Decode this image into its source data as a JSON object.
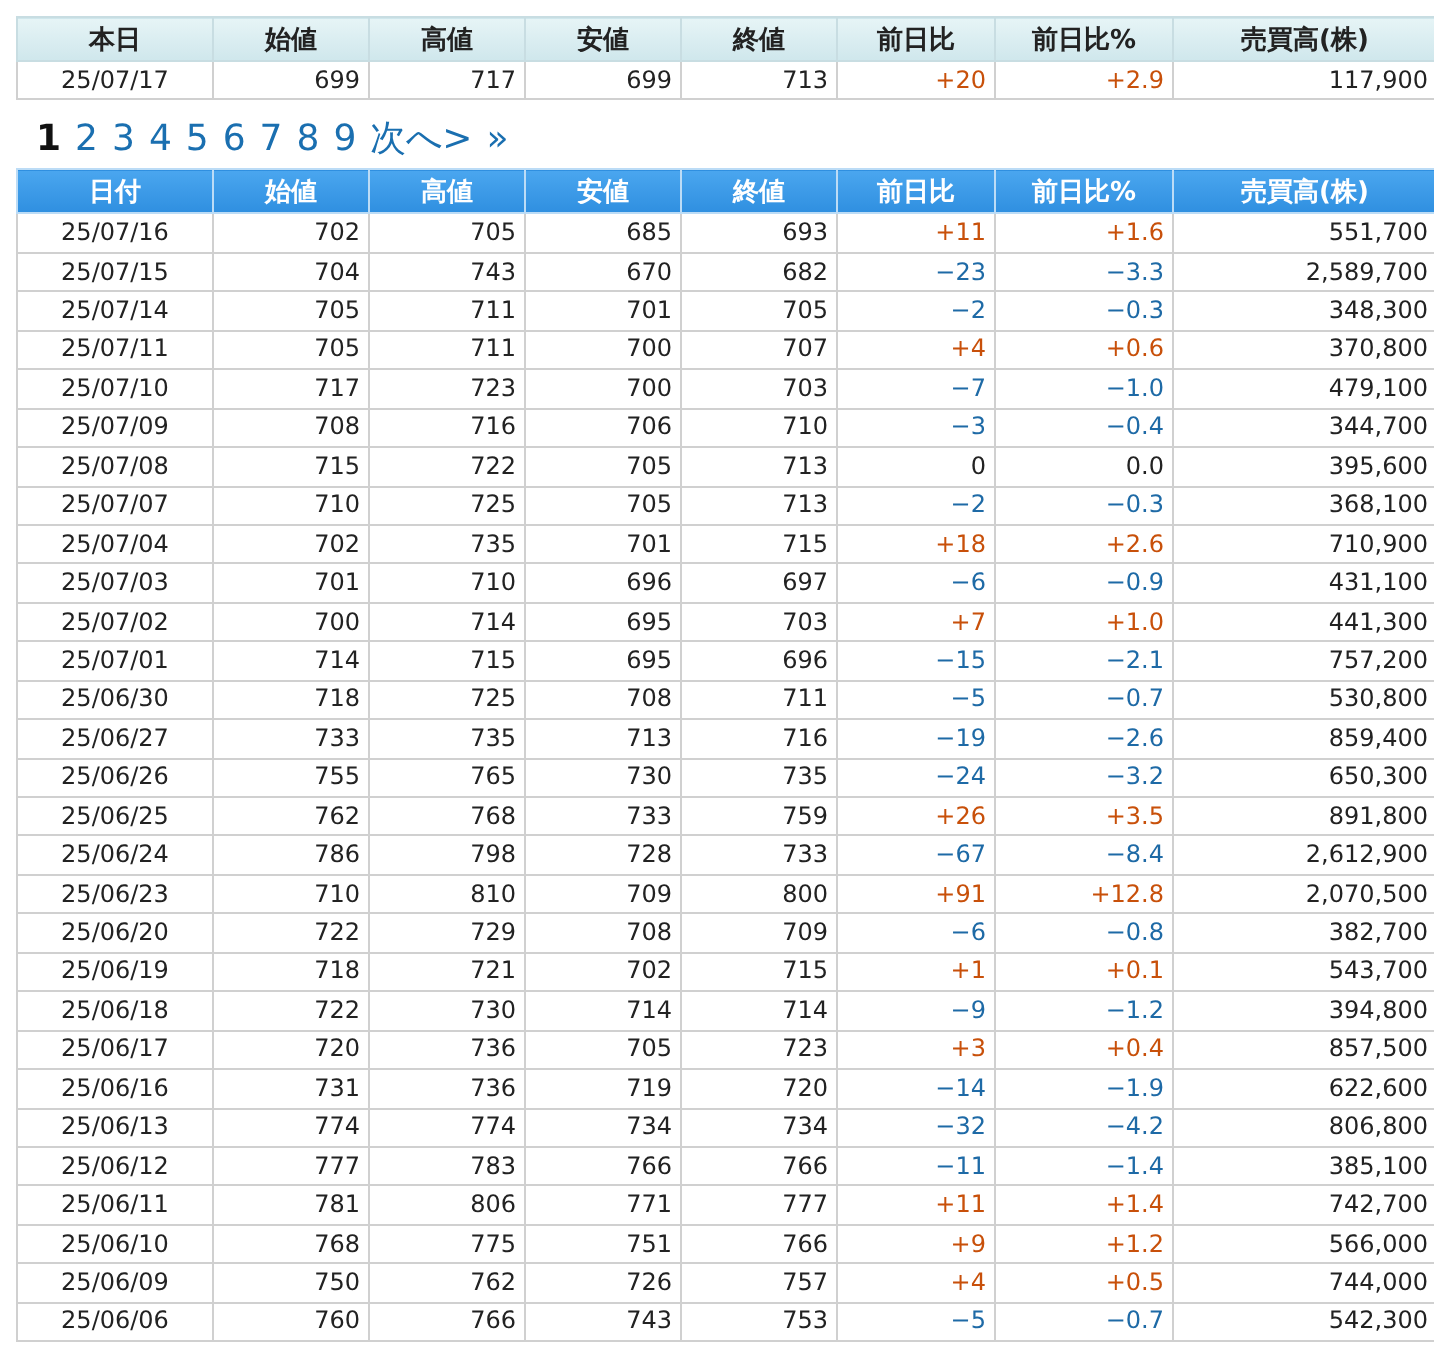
{
  "today_table": {
    "columns": [
      "本日",
      "始値",
      "高値",
      "安値",
      "終値",
      "前日比",
      "前日比%",
      "売買高(株)"
    ],
    "row": {
      "date": "25/07/17",
      "open": "699",
      "high": "717",
      "low": "699",
      "close": "713",
      "change": "+20",
      "change_pct": "+2.9",
      "volume": "117,900",
      "color": "#c8500a"
    }
  },
  "pagination": {
    "pages": [
      {
        "label": "1",
        "selected": true
      },
      {
        "label": "2",
        "selected": false
      },
      {
        "label": "3",
        "selected": false
      },
      {
        "label": "4",
        "selected": false
      },
      {
        "label": "5",
        "selected": false
      },
      {
        "label": "6",
        "selected": false
      },
      {
        "label": "7",
        "selected": false
      },
      {
        "label": "8",
        "selected": false
      },
      {
        "label": "9",
        "selected": false
      }
    ],
    "next": "次へ>",
    "last": "»"
  },
  "history_table": {
    "columns": [
      "日付",
      "始値",
      "高値",
      "安値",
      "終値",
      "前日比",
      "前日比%",
      "売買高(株)"
    ],
    "rows": [
      {
        "date": "25/07/16",
        "open": "702",
        "high": "705",
        "low": "685",
        "close": "693",
        "change": "+11",
        "change_pct": "+1.6",
        "volume": "551,700",
        "color": "#c8500a"
      },
      {
        "date": "25/07/15",
        "open": "704",
        "high": "743",
        "low": "670",
        "close": "682",
        "change": "−23",
        "change_pct": "−3.3",
        "volume": "2,589,700",
        "color": "#1e6aa6"
      },
      {
        "date": "25/07/14",
        "open": "705",
        "high": "711",
        "low": "701",
        "close": "705",
        "change": "−2",
        "change_pct": "−0.3",
        "volume": "348,300",
        "color": "#1e6aa6"
      },
      {
        "date": "25/07/11",
        "open": "705",
        "high": "711",
        "low": "700",
        "close": "707",
        "change": "+4",
        "change_pct": "+0.6",
        "volume": "370,800",
        "color": "#c8500a"
      },
      {
        "date": "25/07/10",
        "open": "717",
        "high": "723",
        "low": "700",
        "close": "703",
        "change": "−7",
        "change_pct": "−1.0",
        "volume": "479,100",
        "color": "#1e6aa6"
      },
      {
        "date": "25/07/09",
        "open": "708",
        "high": "716",
        "low": "706",
        "close": "710",
        "change": "−3",
        "change_pct": "−0.4",
        "volume": "344,700",
        "color": "#1e6aa6"
      },
      {
        "date": "25/07/08",
        "open": "715",
        "high": "722",
        "low": "705",
        "close": "713",
        "change": "0",
        "change_pct": "0.0",
        "volume": "395,600",
        "color": "#222222"
      },
      {
        "date": "25/07/07",
        "open": "710",
        "high": "725",
        "low": "705",
        "close": "713",
        "change": "−2",
        "change_pct": "−0.3",
        "volume": "368,100",
        "color": "#1e6aa6"
      },
      {
        "date": "25/07/04",
        "open": "702",
        "high": "735",
        "low": "701",
        "close": "715",
        "change": "+18",
        "change_pct": "+2.6",
        "volume": "710,900",
        "color": "#c8500a"
      },
      {
        "date": "25/07/03",
        "open": "701",
        "high": "710",
        "low": "696",
        "close": "697",
        "change": "−6",
        "change_pct": "−0.9",
        "volume": "431,100",
        "color": "#1e6aa6"
      },
      {
        "date": "25/07/02",
        "open": "700",
        "high": "714",
        "low": "695",
        "close": "703",
        "change": "+7",
        "change_pct": "+1.0",
        "volume": "441,300",
        "color": "#c8500a"
      },
      {
        "date": "25/07/01",
        "open": "714",
        "high": "715",
        "low": "695",
        "close": "696",
        "change": "−15",
        "change_pct": "−2.1",
        "volume": "757,200",
        "color": "#1e6aa6"
      },
      {
        "date": "25/06/30",
        "open": "718",
        "high": "725",
        "low": "708",
        "close": "711",
        "change": "−5",
        "change_pct": "−0.7",
        "volume": "530,800",
        "color": "#1e6aa6"
      },
      {
        "date": "25/06/27",
        "open": "733",
        "high": "735",
        "low": "713",
        "close": "716",
        "change": "−19",
        "change_pct": "−2.6",
        "volume": "859,400",
        "color": "#1e6aa6"
      },
      {
        "date": "25/06/26",
        "open": "755",
        "high": "765",
        "low": "730",
        "close": "735",
        "change": "−24",
        "change_pct": "−3.2",
        "volume": "650,300",
        "color": "#1e6aa6"
      },
      {
        "date": "25/06/25",
        "open": "762",
        "high": "768",
        "low": "733",
        "close": "759",
        "change": "+26",
        "change_pct": "+3.5",
        "volume": "891,800",
        "color": "#c8500a"
      },
      {
        "date": "25/06/24",
        "open": "786",
        "high": "798",
        "low": "728",
        "close": "733",
        "change": "−67",
        "change_pct": "−8.4",
        "volume": "2,612,900",
        "color": "#1e6aa6"
      },
      {
        "date": "25/06/23",
        "open": "710",
        "high": "810",
        "low": "709",
        "close": "800",
        "change": "+91",
        "change_pct": "+12.8",
        "volume": "2,070,500",
        "color": "#c8500a"
      },
      {
        "date": "25/06/20",
        "open": "722",
        "high": "729",
        "low": "708",
        "close": "709",
        "change": "−6",
        "change_pct": "−0.8",
        "volume": "382,700",
        "color": "#1e6aa6"
      },
      {
        "date": "25/06/19",
        "open": "718",
        "high": "721",
        "low": "702",
        "close": "715",
        "change": "+1",
        "change_pct": "+0.1",
        "volume": "543,700",
        "color": "#c8500a"
      },
      {
        "date": "25/06/18",
        "open": "722",
        "high": "730",
        "low": "714",
        "close": "714",
        "change": "−9",
        "change_pct": "−1.2",
        "volume": "394,800",
        "color": "#1e6aa6"
      },
      {
        "date": "25/06/17",
        "open": "720",
        "high": "736",
        "low": "705",
        "close": "723",
        "change": "+3",
        "change_pct": "+0.4",
        "volume": "857,500",
        "color": "#c8500a"
      },
      {
        "date": "25/06/16",
        "open": "731",
        "high": "736",
        "low": "719",
        "close": "720",
        "change": "−14",
        "change_pct": "−1.9",
        "volume": "622,600",
        "color": "#1e6aa6"
      },
      {
        "date": "25/06/13",
        "open": "774",
        "high": "774",
        "low": "734",
        "close": "734",
        "change": "−32",
        "change_pct": "−4.2",
        "volume": "806,800",
        "color": "#1e6aa6"
      },
      {
        "date": "25/06/12",
        "open": "777",
        "high": "783",
        "low": "766",
        "close": "766",
        "change": "−11",
        "change_pct": "−1.4",
        "volume": "385,100",
        "color": "#1e6aa6"
      },
      {
        "date": "25/06/11",
        "open": "781",
        "high": "806",
        "low": "771",
        "close": "777",
        "change": "+11",
        "change_pct": "+1.4",
        "volume": "742,700",
        "color": "#c8500a"
      },
      {
        "date": "25/06/10",
        "open": "768",
        "high": "775",
        "low": "751",
        "close": "766",
        "change": "+9",
        "change_pct": "+1.2",
        "volume": "566,000",
        "color": "#c8500a"
      },
      {
        "date": "25/06/09",
        "open": "750",
        "high": "762",
        "low": "726",
        "close": "757",
        "change": "+4",
        "change_pct": "+0.5",
        "volume": "744,000",
        "color": "#c8500a"
      },
      {
        "date": "25/06/06",
        "open": "760",
        "high": "766",
        "low": "743",
        "close": "753",
        "change": "−5",
        "change_pct": "−0.7",
        "volume": "542,300",
        "color": "#1e6aa6"
      }
    ]
  }
}
